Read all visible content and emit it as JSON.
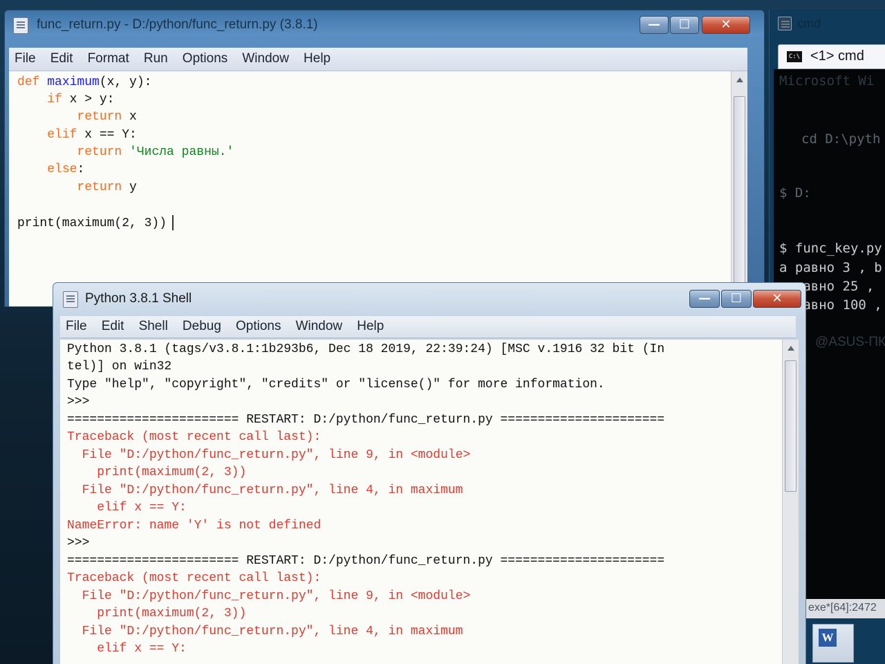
{
  "editor": {
    "title": "func_return.py - D:/python/func_return.py (3.8.1)",
    "menu": [
      "File",
      "Edit",
      "Format",
      "Run",
      "Options",
      "Window",
      "Help"
    ],
    "buttons": {
      "minimize": "—",
      "maximize": "☐",
      "close": "✕"
    },
    "code": {
      "l1": [
        "def",
        " ",
        "maximum",
        "(x, y):"
      ],
      "l2": [
        "    ",
        "if",
        " x > y:"
      ],
      "l3": [
        "        ",
        "return",
        " x"
      ],
      "l4": [
        "    ",
        "elif",
        " x == Y:"
      ],
      "l5": [
        "        ",
        "return",
        " ",
        "'Числа равны.'"
      ],
      "l6": [
        "    ",
        "else",
        ":"
      ],
      "l7": [
        "        ",
        "return",
        " y"
      ],
      "l8": "print(maximum(2, 3))"
    }
  },
  "cmd": {
    "title": "cmd",
    "tab_label": "<1> cmd",
    "tab_icon": "C:\\",
    "lines": [
      "Microsoft Wi",
      "cd D:\\pyth",
      "$ D:",
      "$ func_key.py",
      "a равно 3 , b",
      "a равно 25 ,",
      "a равно 100 ,",
      "@ASUS-ПК"
    ],
    "status": "exe*[64]:2472",
    "taskbar_icon": "W"
  },
  "shell": {
    "title": "Python 3.8.1 Shell",
    "menu": [
      "File",
      "Edit",
      "Shell",
      "Debug",
      "Options",
      "Window",
      "Help"
    ],
    "buttons": {
      "minimize": "—",
      "maximize": "☐",
      "close": "✕"
    },
    "lines": [
      "Python 3.8.1 (tags/v3.8.1:1b293b6, Dec 18 2019, 22:39:24) [MSC v.1916 32 bit (In",
      "tel)] on win32",
      "Type \"help\", \"copyright\", \"credits\" or \"license()\" for more information.",
      ">>>",
      "======================= RESTART: D:/python/func_return.py ======================",
      "Traceback (most recent call last):",
      "  File \"D:/python/func_return.py\", line 9, in <module>",
      "    print(maximum(2, 3))",
      "  File \"D:/python/func_return.py\", line 4, in maximum",
      "    elif x == Y:",
      "NameError: name 'Y' is not defined",
      ">>>",
      "======================= RESTART: D:/python/func_return.py ======================",
      "Traceback (most recent call last):",
      "  File \"D:/python/func_return.py\", line 9, in <module>",
      "    print(maximum(2, 3))",
      "  File \"D:/python/func_return.py\", line 4, in maximum",
      "    elif x == Y:"
    ],
    "error_color": "#e4392f"
  },
  "colors": {
    "keyword": "#ff6a1a",
    "builtin": "#1a1aff",
    "string": "#0b8a1c",
    "error": "#e4392f"
  }
}
